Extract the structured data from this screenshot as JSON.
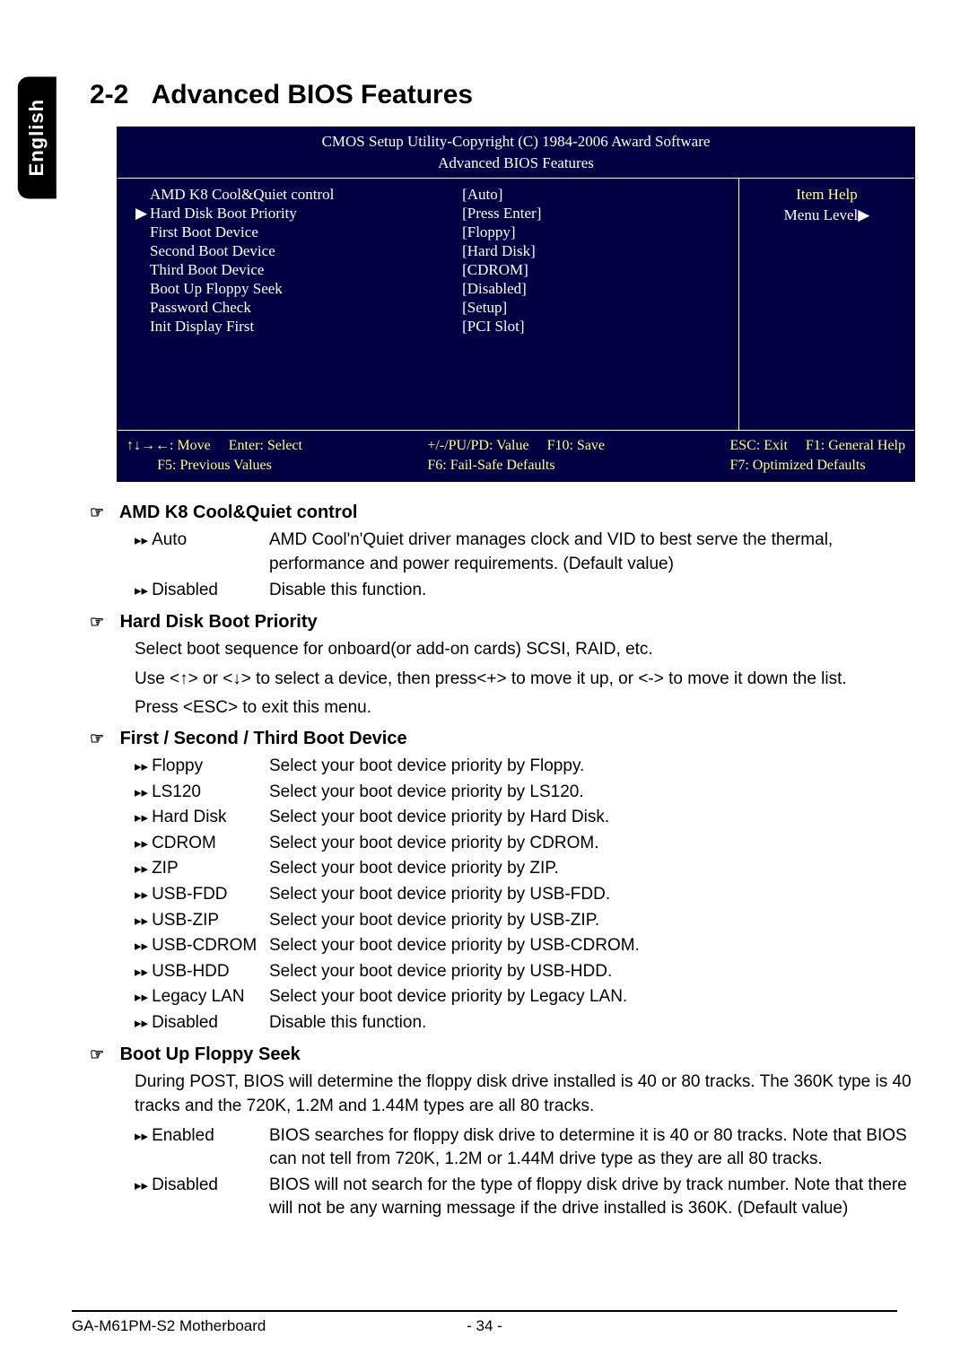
{
  "lang_tab": "English",
  "section": {
    "num": "2-2",
    "title": "Advanced BIOS Features"
  },
  "bios": {
    "header1": "CMOS Setup Utility-Copyright (C) 1984-2006 Award Software",
    "header2": "Advanced BIOS Features",
    "rows": [
      {
        "ptr": "",
        "label": "AMD K8 Cool&Quiet control",
        "value": "[Auto]"
      },
      {
        "ptr": "▶",
        "label": "Hard Disk Boot Priority",
        "value": "[Press Enter]"
      },
      {
        "ptr": "",
        "label": "First Boot Device",
        "value": "[Floppy]"
      },
      {
        "ptr": "",
        "label": "Second Boot Device",
        "value": "[Hard Disk]"
      },
      {
        "ptr": "",
        "label": "Third Boot Device",
        "value": "[CDROM]"
      },
      {
        "ptr": "",
        "label": "Boot Up Floppy Seek",
        "value": "[Disabled]"
      },
      {
        "ptr": "",
        "label": "Password Check",
        "value": "[Setup]"
      },
      {
        "ptr": "",
        "label": "Init Display First",
        "value": "[PCI Slot]"
      }
    ],
    "item_help": "Item Help",
    "menu_level": "Menu Level▶",
    "footer": {
      "move": "↑↓→←: Move",
      "select": "Enter: Select",
      "value": "+/-/PU/PD: Value",
      "save": "F10: Save",
      "exit": "ESC: Exit",
      "help": "F1: General Help",
      "prev": "F5: Previous Values",
      "failsafe": "F6: Fail-Safe Defaults",
      "optimized": "F7: Optimized Defaults"
    }
  },
  "opts": {
    "amd": {
      "title": "AMD K8 Cool&Quiet control",
      "auto_k": "Auto",
      "auto_d": "AMD Cool'n'Quiet driver manages clock and VID to best serve the thermal, performance and power requirements. (Default value)",
      "dis_k": "Disabled",
      "dis_d": "Disable this function."
    },
    "hdbp": {
      "title": "Hard Disk Boot Priority",
      "l1": "Select boot sequence for onboard(or add-on cards) SCSI, RAID, etc.",
      "l2": "Use <↑> or <↓> to select a device, then press<+> to move it up, or <-> to move it down the list.",
      "l3": "Press <ESC> to exit this menu."
    },
    "bootdev": {
      "title": "First / Second / Third Boot Device",
      "items": [
        {
          "k": "Floppy",
          "d": "Select your boot device priority by Floppy."
        },
        {
          "k": "LS120",
          "d": "Select your boot device priority by LS120."
        },
        {
          "k": "Hard Disk",
          "d": "Select your boot device priority by Hard Disk."
        },
        {
          "k": "CDROM",
          "d": "Select your boot device priority by CDROM."
        },
        {
          "k": "ZIP",
          "d": "Select your boot device priority by ZIP."
        },
        {
          "k": "USB-FDD",
          "d": "Select your boot device priority by USB-FDD."
        },
        {
          "k": "USB-ZIP",
          "d": "Select your boot device priority by USB-ZIP."
        },
        {
          "k": "USB-CDROM",
          "d": "Select your boot device priority by USB-CDROM."
        },
        {
          "k": "USB-HDD",
          "d": "Select your boot device priority by USB-HDD."
        },
        {
          "k": "Legacy LAN",
          "d": "Select your boot device priority by Legacy LAN."
        },
        {
          "k": "Disabled",
          "d": "Disable this function."
        }
      ]
    },
    "floppyseek": {
      "title": "Boot Up Floppy Seek",
      "intro": "During POST, BIOS will determine the floppy disk drive installed is 40 or 80 tracks. The 360K type is 40 tracks and the 720K, 1.2M and 1.44M types are all 80 tracks.",
      "en_k": "Enabled",
      "en_d": "BIOS searches for floppy disk drive to determine it is 40 or 80 tracks. Note that BIOS can not tell from 720K, 1.2M or 1.44M drive type as they are all 80 tracks.",
      "dis_k": "Disabled",
      "dis_d": "BIOS will not search for the type of floppy disk drive by track number. Note that there will not be any warning message if the drive installed is 360K. (Default value)"
    }
  },
  "footer": {
    "board": "GA-M61PM-S2 Motherboard",
    "page": "- 34 -"
  },
  "glyphs": {
    "hand": "☞",
    "fwd": "▸▸"
  }
}
